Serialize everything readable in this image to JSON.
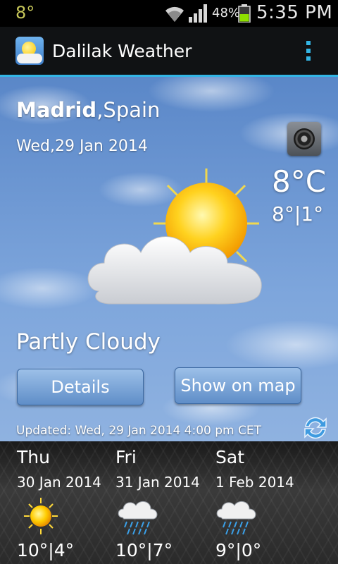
{
  "statusbar": {
    "left_temp": "8°",
    "battery_pct": "48%",
    "time": "5:35 PM"
  },
  "actionbar": {
    "title": "Dalilak Weather",
    "icons": [
      "app-weather-icon",
      "overflow-menu-icon"
    ]
  },
  "current": {
    "city": "Madrid",
    "country": ",Spain",
    "date": "Wed,29 Jan 2014",
    "temperature": "8°C",
    "min_max": "8°|1°",
    "condition": "Partly Cloudy",
    "weather_icon": "partly-cloudy-icon",
    "sound_icon": "speaker-icon"
  },
  "buttons": {
    "details": "Details",
    "show_on_map": "Show on map"
  },
  "updated": "Updated: Wed, 29 Jan 2014 4:00 pm CET",
  "forecast": [
    {
      "day": "Thu",
      "date": "30 Jan 2014",
      "temp": "10°|4°",
      "icon": "sunny-icon"
    },
    {
      "day": "Fri",
      "date": "31 Jan 2014",
      "temp": "10°|7°",
      "icon": "rain-cloud-icon"
    },
    {
      "day": "Sat",
      "date": "1 Feb 2014",
      "temp": "9°|0°",
      "icon": "rain-cloud-icon"
    }
  ],
  "colors": {
    "accent": "#33b5e5",
    "sky": "#7ea6dc",
    "button": "#6f9dd4"
  }
}
